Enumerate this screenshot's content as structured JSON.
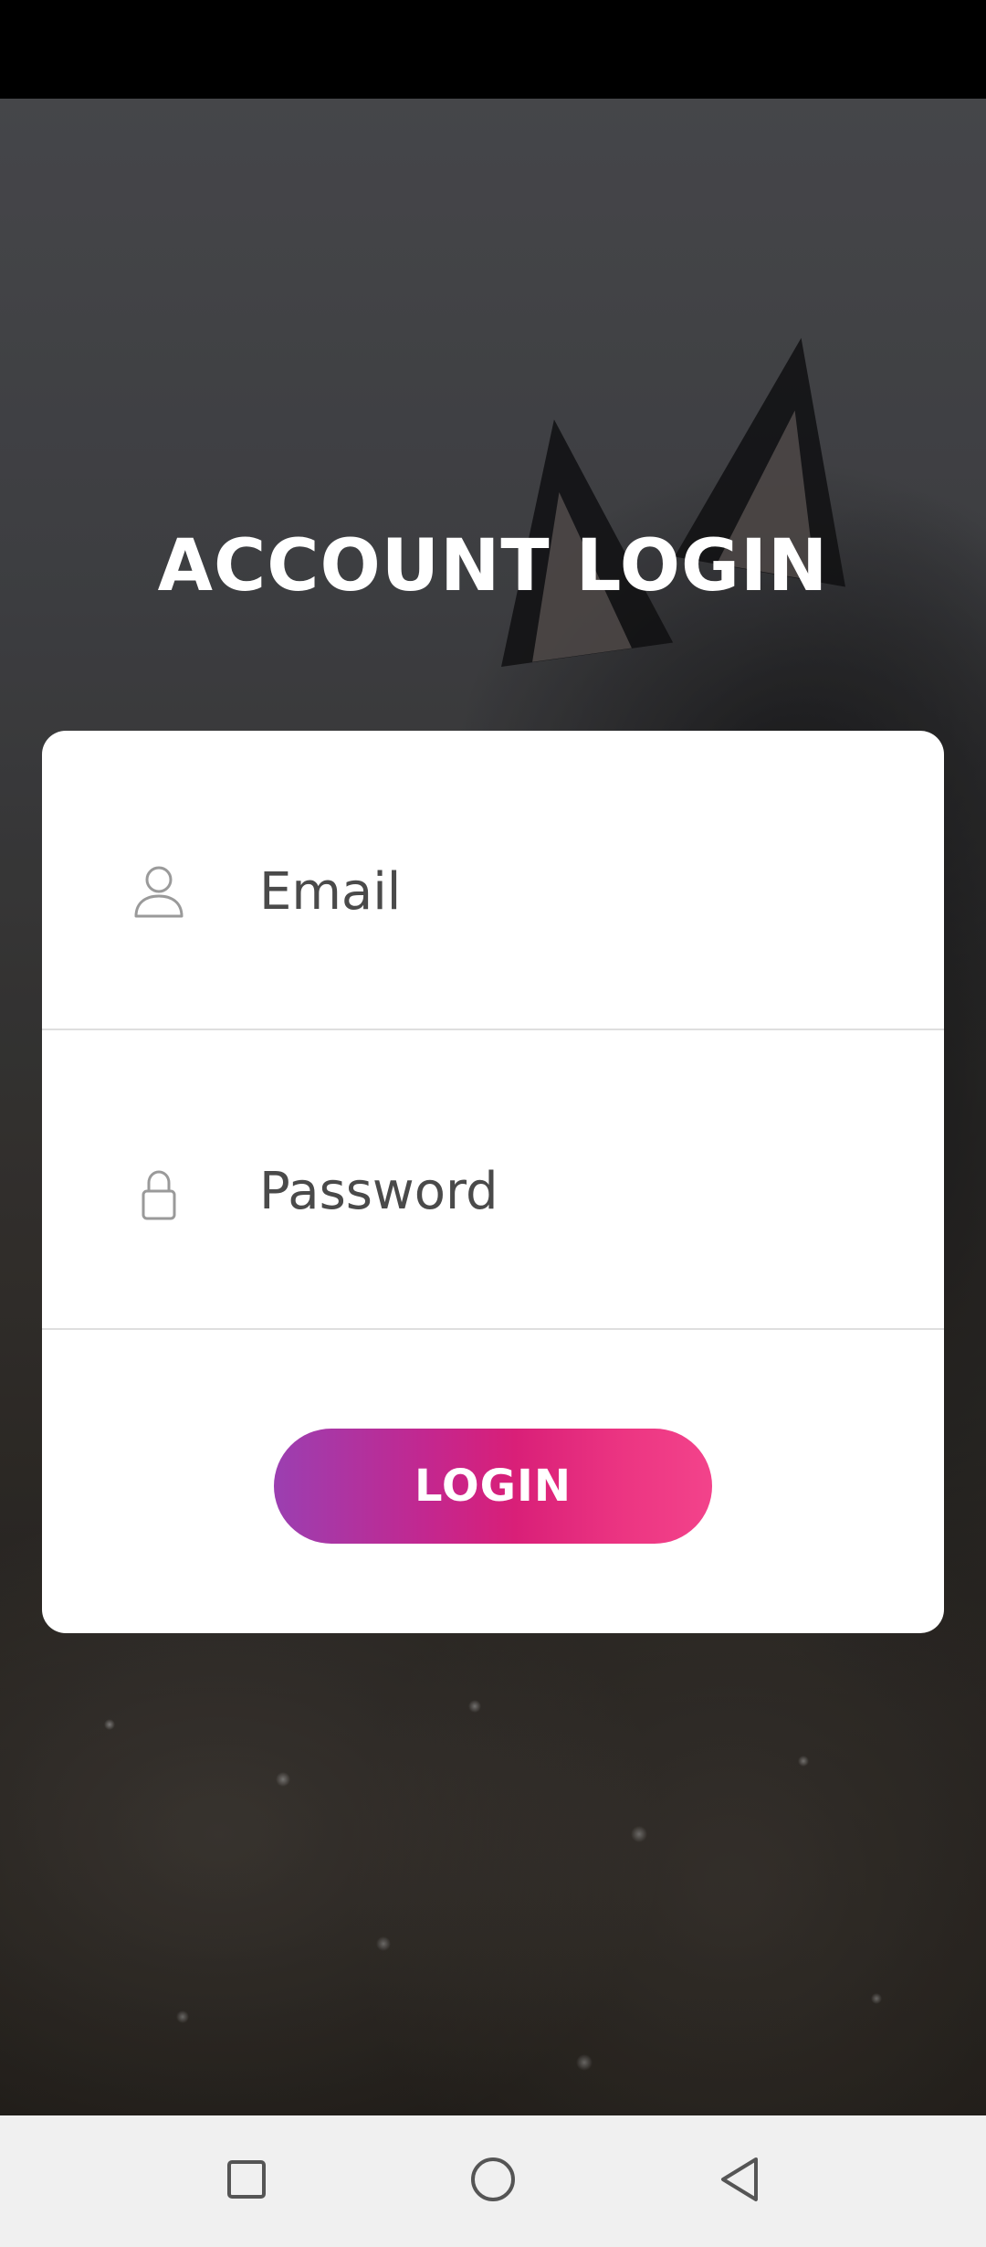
{
  "header": {
    "title": "ACCOUNT LOGIN"
  },
  "form": {
    "email": {
      "icon": "user-icon",
      "placeholder": "Email",
      "value": ""
    },
    "password": {
      "icon": "lock-icon",
      "placeholder": "Password",
      "value": ""
    },
    "login_label": "LOGIN"
  },
  "nav_bar": {
    "recents_icon": "square-icon",
    "home_icon": "circle-icon",
    "back_icon": "triangle-back-icon"
  },
  "colors": {
    "button_gradient_start": "#9b3fb1",
    "button_gradient_end": "#f3438b",
    "card_background": "#ffffff",
    "title_color": "#ffffff"
  }
}
